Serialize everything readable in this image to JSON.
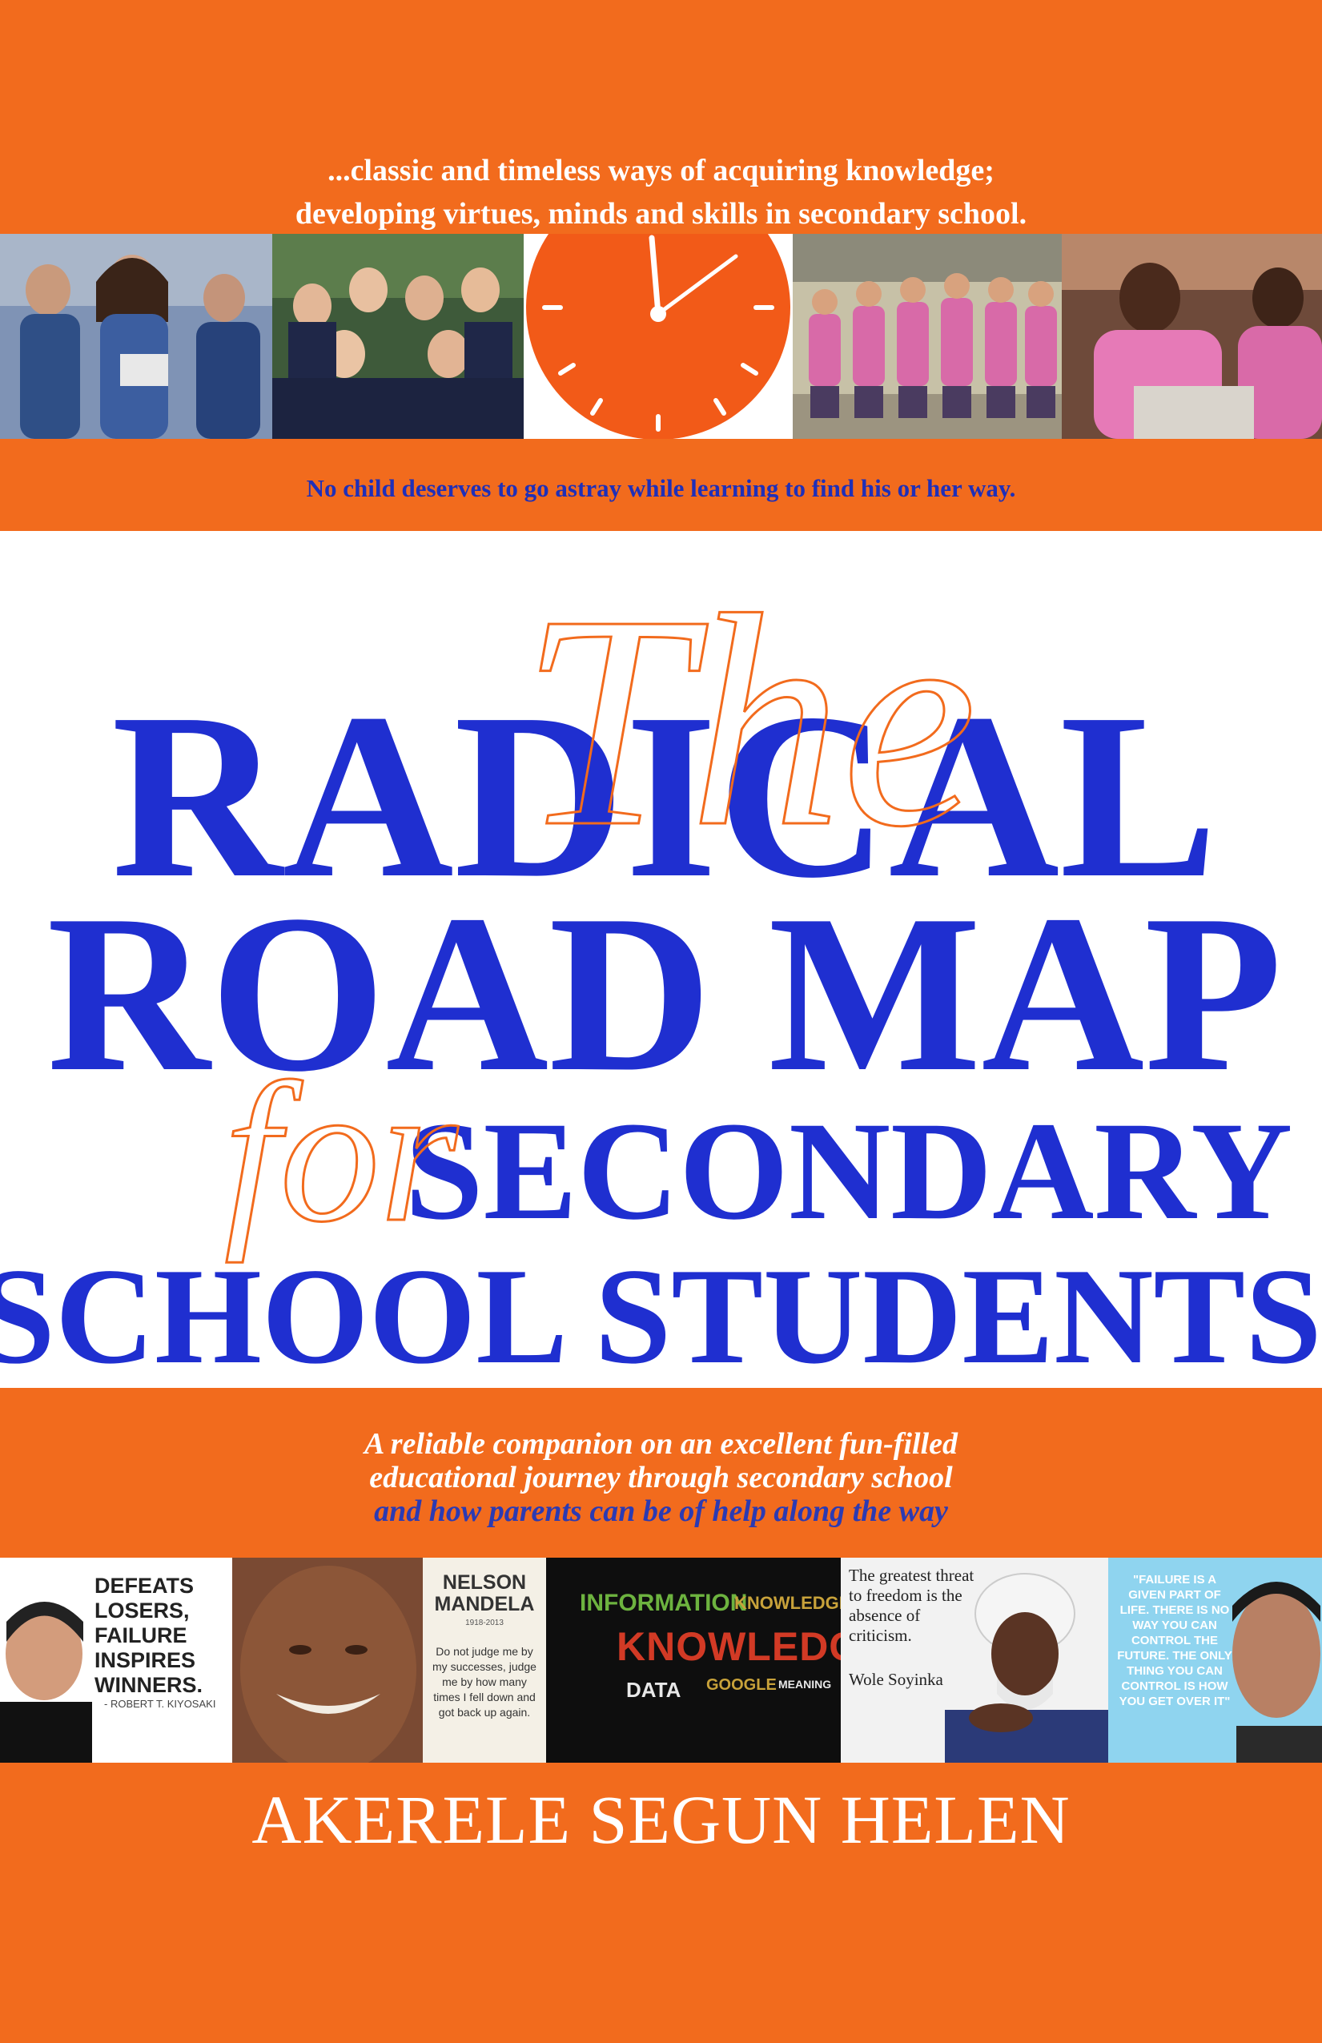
{
  "cover": {
    "tagline_top_line1": "...classic and timeless ways of acquiring knowledge;",
    "tagline_top_line2": "developing virtues, minds and skills in secondary school.",
    "tagline_mid": "No child deserves to go astray while learning to find his or her way.",
    "title_script_the": "The",
    "title_line1": "RADICAL",
    "title_line2": "ROAD MAP",
    "title_script_for": "for",
    "title_line3": "SECONDARY",
    "title_line4": "SCHOOL STUDENTS",
    "subtitle_line1": "A reliable companion on an excellent fun-filled",
    "subtitle_line2": "educational journey through secondary school",
    "subtitle_line3": "and how parents can be of help along the way",
    "author": "AKERELE SEGUN HELEN"
  },
  "quotes": {
    "kiyosaki_text": "DEFEATS LOSERS, FAILURE INSPIRES WINNERS.",
    "kiyosaki_author": "- ROBERT T. KIYOSAKI",
    "mandela_name": "NELSON MANDELA",
    "mandela_years": "1918-2013",
    "mandela_text": "Do not judge me by my successes, judge me by how many times I fell down and got back up again.",
    "cloud_information": "INFORMATION",
    "cloud_knowledge": "KNOWLEDGE",
    "cloud_knowledge_small": "KNOWLEDGE",
    "cloud_data": "DATA",
    "cloud_google": "GOOGLE",
    "cloud_meaning": "MEANING",
    "soyinka_text": "The greatest threat to freedom is the absence of criticism.",
    "soyinka_author": "Wole Soyinka",
    "madhavan_text": "\"FAILURE IS A GIVEN PART OF LIFE. THERE IS NO WAY YOU CAN CONTROL THE FUTURE. THE ONLY THING YOU CAN CONTROL IS HOW YOU GET OVER IT\""
  },
  "colors": {
    "orange": "#f26b1d",
    "blue": "#1f2fd0",
    "white": "#ffffff"
  },
  "icons": {
    "clock": "clock-icon"
  }
}
